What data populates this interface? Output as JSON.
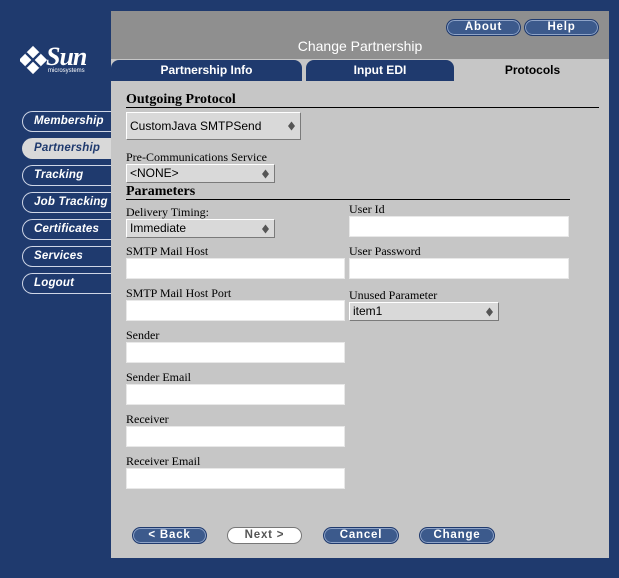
{
  "brand": {
    "name": "Sun",
    "sub": "microsystems"
  },
  "nav": [
    {
      "label": "Membership",
      "active": false
    },
    {
      "label": "Partnership",
      "active": true
    },
    {
      "label": "Tracking",
      "active": false
    },
    {
      "label": "Job Tracking",
      "active": false
    },
    {
      "label": "Certificates",
      "active": false
    },
    {
      "label": "Services",
      "active": false
    },
    {
      "label": "Logout",
      "active": false
    }
  ],
  "header": {
    "title": "Change Partnership",
    "about": "About",
    "help": "Help"
  },
  "tabs": [
    {
      "label": "Partnership Info",
      "active": false
    },
    {
      "label": "Input EDI",
      "active": false
    },
    {
      "label": "Protocols",
      "active": true
    }
  ],
  "form": {
    "outgoing_heading": "Outgoing Protocol",
    "outgoing_value": "CustomJava SMTPSend",
    "precomm_label": "Pre-Communications Service",
    "precomm_value": "<NONE>",
    "params_heading": "Parameters",
    "delivery_label": "Delivery Timing:",
    "delivery_value": "Immediate",
    "user_id_label": "User Id",
    "user_id_value": "",
    "smtp_host_label": "SMTP Mail Host",
    "smtp_host_value": "",
    "user_password_label": "User Password",
    "user_password_value": "",
    "smtp_port_label": "SMTP Mail Host Port",
    "smtp_port_value": "",
    "unused_label": "Unused Parameter",
    "unused_value": "item1",
    "sender_label": "Sender",
    "sender_value": "",
    "sender_email_label": "Sender Email",
    "sender_email_value": "",
    "receiver_label": "Receiver",
    "receiver_value": "",
    "receiver_email_label": "Receiver Email",
    "receiver_email_value": ""
  },
  "buttons": {
    "back": "< Back",
    "next": "Next >",
    "cancel": "Cancel",
    "change": "Change"
  }
}
